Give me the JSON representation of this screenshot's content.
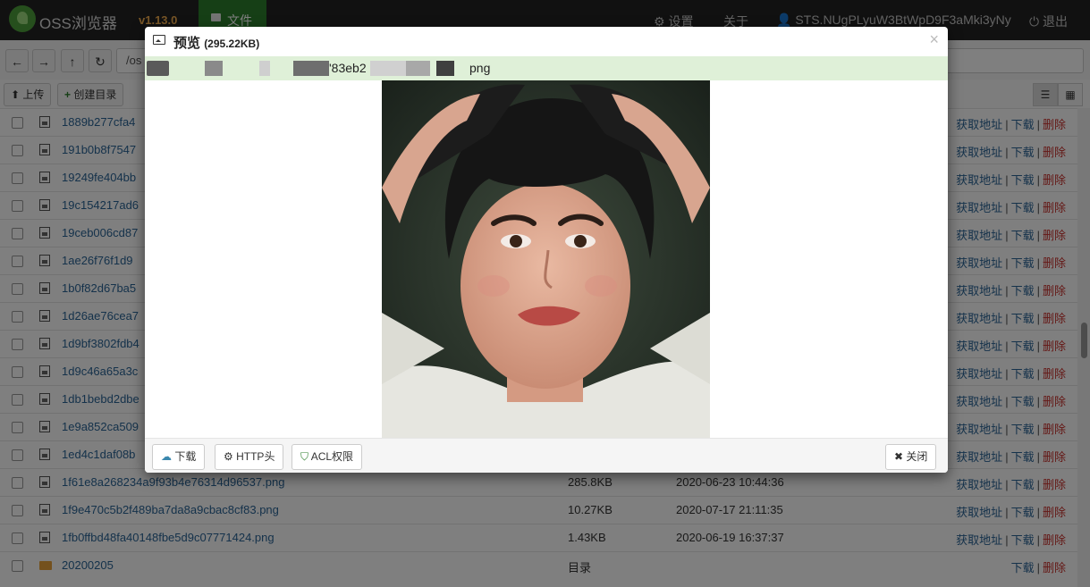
{
  "navbar": {
    "brand": "OSS浏览器",
    "version": "v1.13.0",
    "files_tab": "文件",
    "settings": "⚙ 设置",
    "about": "关于",
    "user": "👤 STS.NUgPLyuW3BtWpD9F3aMki3yNy",
    "logout": "⏻ 退出"
  },
  "toolbar": {
    "path": "/os",
    "upload_label": "上传",
    "mkdir_label": "创建目录",
    "back_glyph": "←",
    "forward_glyph": "→",
    "up_glyph": "↑",
    "refresh_glyph": "↻",
    "list_view_glyph": "☰",
    "grid_view_glyph": "▦"
  },
  "actions": {
    "get_url": "获取地址",
    "download": "下载",
    "delete": "删除",
    "separator": "|"
  },
  "files": [
    {
      "name": "1889b277cfa4",
      "size": "",
      "date": "",
      "type": "image"
    },
    {
      "name": "191b0b8f7547",
      "size": "",
      "date": "",
      "type": "image"
    },
    {
      "name": "19249fe404bb",
      "size": "",
      "date": "",
      "type": "image"
    },
    {
      "name": "19c154217ad6",
      "size": "",
      "date": "",
      "type": "image"
    },
    {
      "name": "19ceb006cd87",
      "size": "",
      "date": "",
      "type": "image"
    },
    {
      "name": "1ae26f76f1d9",
      "size": "",
      "date": "",
      "type": "image"
    },
    {
      "name": "1b0f82d67ba5",
      "size": "",
      "date": "",
      "type": "image"
    },
    {
      "name": "1d26ae76cea7",
      "size": "",
      "date": "",
      "type": "image"
    },
    {
      "name": "1d9bf3802fdb4",
      "size": "",
      "date": "",
      "type": "image"
    },
    {
      "name": "1d9c46a65a3c",
      "size": "",
      "date": "",
      "type": "image"
    },
    {
      "name": "1db1bebd2dbe",
      "size": "",
      "date": "",
      "type": "image"
    },
    {
      "name": "1e9a852ca509",
      "size": "",
      "date": "",
      "type": "image"
    },
    {
      "name": "1ed4c1daf08b",
      "size": "",
      "date": "",
      "type": "image"
    },
    {
      "name": "1f61e8a268234a9f93b4e76314d96537.png",
      "size": "285.8KB",
      "date": "2020-06-23 10:44:36",
      "type": "image"
    },
    {
      "name": "1f9e470c5b2f489ba7da8a9cbac8cf83.png",
      "size": "10.27KB",
      "date": "2020-07-17 21:11:35",
      "type": "image"
    },
    {
      "name": "1fb0ffbd48fa40148fbe5d9c07771424.png",
      "size": "1.43KB",
      "date": "2020-06-19 16:37:37",
      "type": "image"
    },
    {
      "name": "20200205",
      "size": "目录",
      "date": "",
      "type": "folder"
    }
  ],
  "modal": {
    "title": "预览",
    "size": "(295.22KB)",
    "close_glyph": "×",
    "path_visible_part1": "'83eb2",
    "path_visible_part2": "png",
    "download_label": "下载",
    "http_headers_label": "HTTP头",
    "acl_label": "ACL权限",
    "close_label": "关闭",
    "close_btn_glyph": "✖"
  },
  "colors": {
    "navbar": "#222222",
    "files_tab": "#2c7f2c",
    "version": "#f0ad4e",
    "link": "#2a6496",
    "delete": "#c9302c",
    "path_bar": "#dff0d8"
  },
  "icons": {
    "upload": "upload-icon",
    "plus": "plus-icon",
    "download_cloud": "cloud-download-icon",
    "gear": "gear-icon",
    "shield": "shield-icon",
    "image": "image-icon"
  }
}
